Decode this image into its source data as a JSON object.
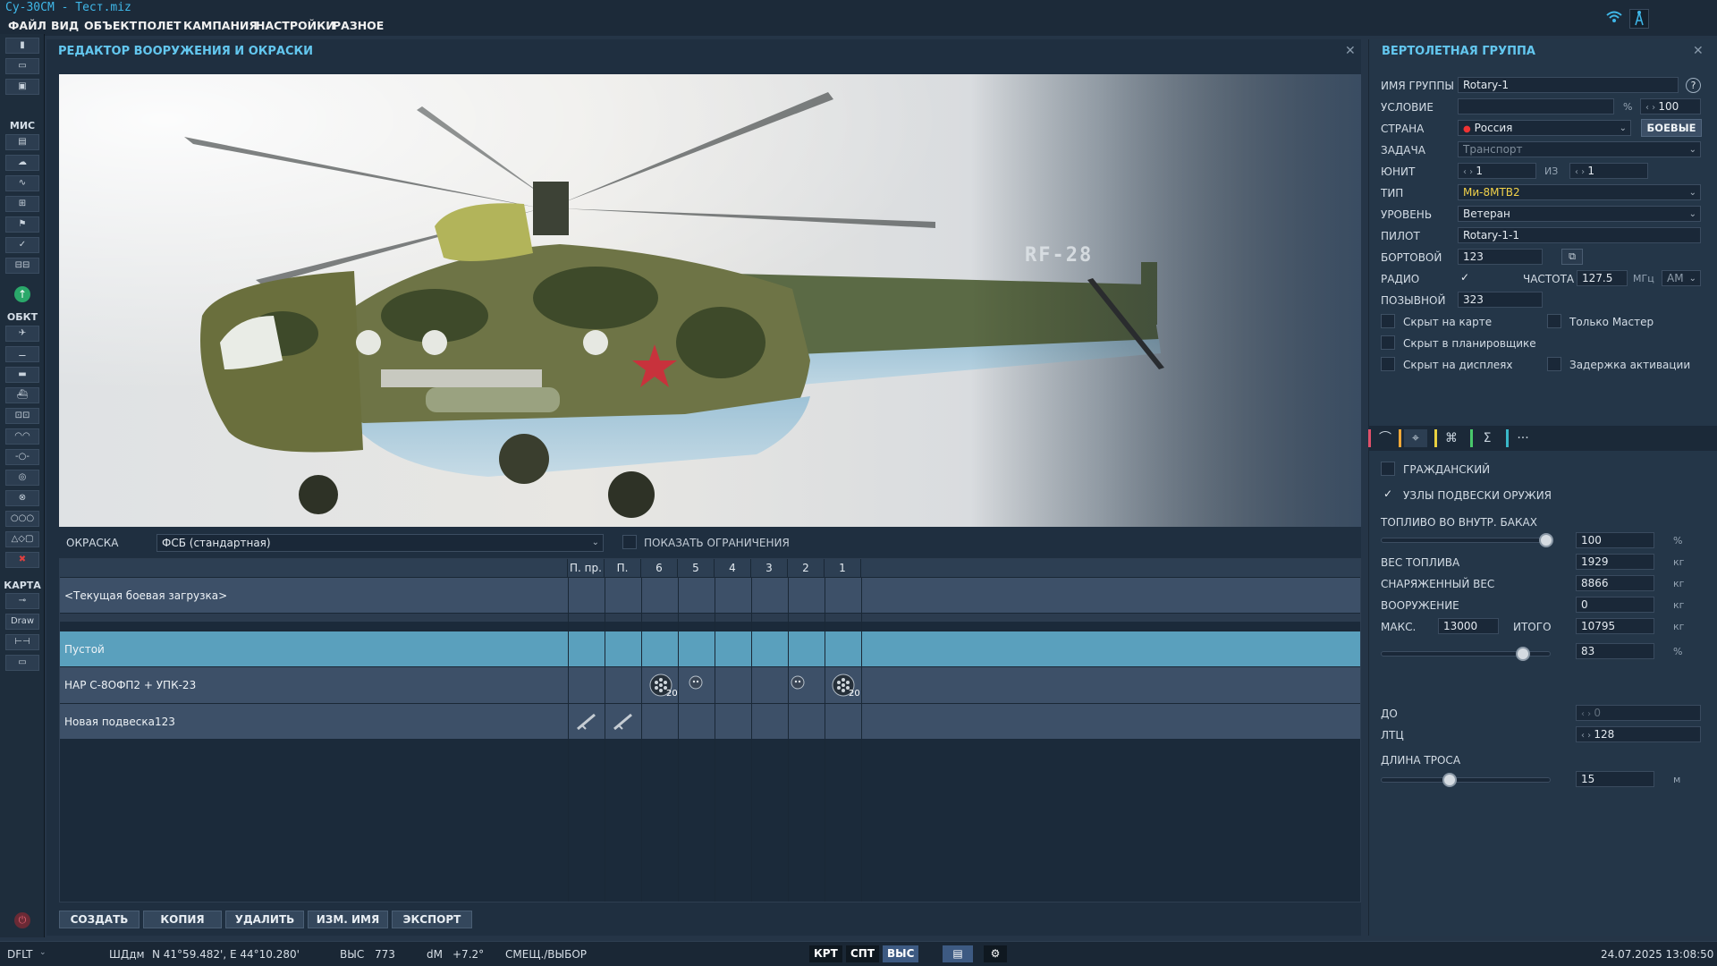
{
  "app": {
    "title": "Су-30СМ - Тест.miz"
  },
  "menu": [
    "ФАЙЛ",
    "ВИД",
    "ОБЪЕКТ",
    "ПОЛЕТ",
    "КАМПАНИЯ",
    "НАСТРОЙКИ",
    "РАЗНОЕ"
  ],
  "toolbar": {
    "mission_label": "МИС",
    "objects_label": "ОБКТ",
    "map_label": "КАРТА",
    "draw_label": "Draw"
  },
  "editor": {
    "title": "РЕДАКТОР ВООРУЖЕНИЯ И ОКРАСКИ",
    "livery_label": "ОКРАСКА",
    "livery_value": "ФСБ (стандартная)",
    "show_limits_label": "ПОКАЗАТЬ ОГРАНИЧЕНИЯ",
    "columns": [
      "П. пр.",
      "П. лев.",
      "6",
      "5",
      "4",
      "3",
      "2",
      "1"
    ],
    "current_loadout": "<Текущая боевая загрузка>",
    "rows": [
      {
        "name": "Пустой"
      },
      {
        "name": "НАР С-8ОФП2 + УПК-23",
        "count_a": "20",
        "count_b": "20"
      },
      {
        "name": "Новая подвеска123"
      }
    ],
    "buttons": [
      "СОЗДАТЬ",
      "КОПИЯ",
      "УДАЛИТЬ",
      "ИЗМ. ИМЯ",
      "ЭКСПОРТ"
    ],
    "tail_number": "RF-28"
  },
  "group": {
    "title": "ВЕРТОЛЕТНАЯ ГРУППА",
    "name_label": "ИМЯ ГРУППЫ",
    "name_value": "Rotary-1",
    "condition_label": "УСЛОВИЕ",
    "condition_pct": "%",
    "condition_value": "100",
    "country_label": "СТРАНА",
    "country_value": "Россия",
    "combat_btn": "БОЕВЫЕ",
    "task_label": "ЗАДАЧА",
    "task_value": "Транспорт",
    "unit_label": "ЮНИТ",
    "unit_value": "1",
    "of_label": "ИЗ",
    "of_value": "1",
    "type_label": "ТИП",
    "type_value": "Ми-8МТВ2",
    "skill_label": "УРОВЕНЬ",
    "skill_value": "Ветеран",
    "pilot_label": "ПИЛОТ",
    "pilot_value": "Rotary-1-1",
    "board_label": "БОРТОВОЙ",
    "board_value": "123",
    "radio_label": "РАДИО",
    "freq_label": "ЧАСТОТА",
    "freq_value": "127.5",
    "freq_unit": "МГц",
    "mod_value": "AM",
    "callsign_label": "ПОЗЫВНОЙ",
    "callsign_value": "323",
    "hidden_map": "Скрыт на карте",
    "master_only": "Только Мастер",
    "hidden_planner": "Скрыт в планировщике",
    "hidden_displays": "Скрыт на дисплеях",
    "late_activation": "Задержка активации",
    "civil_label": "ГРАЖДАНСКИЙ",
    "pylons_label": "УЗЛЫ ПОДВЕСКИ ОРУЖИЯ",
    "fuel_label": "ТОПЛИВО ВО ВНУТР. БАКАХ",
    "fuel_value": "100",
    "pct": "%",
    "fuel_fraction": 0.97,
    "fuel_weight_label": "ВЕС ТОПЛИВА",
    "fuel_weight_value": "1929",
    "kg": "кг",
    "empty_weight_label": "СНАРЯЖЕННЫЙ ВЕС",
    "empty_weight_value": "8866",
    "weapons_label": "ВООРУЖЕНИЕ",
    "weapons_value": "0",
    "max_label": "МАКС.",
    "max_value": "13000",
    "total_label": "ИТОГО",
    "total_value": "10795",
    "load_pct_value": "83",
    "load_fraction": 0.83,
    "do_label": "ДО",
    "do_value": "0",
    "ltc_label": "ЛТЦ",
    "ltc_value": "128",
    "rope_label": "ДЛИНА ТРОСА",
    "rope_value": "15",
    "rope_unit": "м",
    "rope_fraction": 0.4
  },
  "status": {
    "profile": "DFLT",
    "coord_label": "ШДдм",
    "coords": "N 41°59.482', E 44°10.280'",
    "alt_label": "ВЫС",
    "alt_value": "773",
    "dm_label": "dM",
    "dm_value": "+7.2°",
    "mode": "СМЕЩ./ВЫБОР",
    "btn_krt": "КРТ",
    "btn_spt": "СПТ",
    "btn_vys": "ВЫС",
    "datetime": "24.07.2025 13:08:50"
  }
}
